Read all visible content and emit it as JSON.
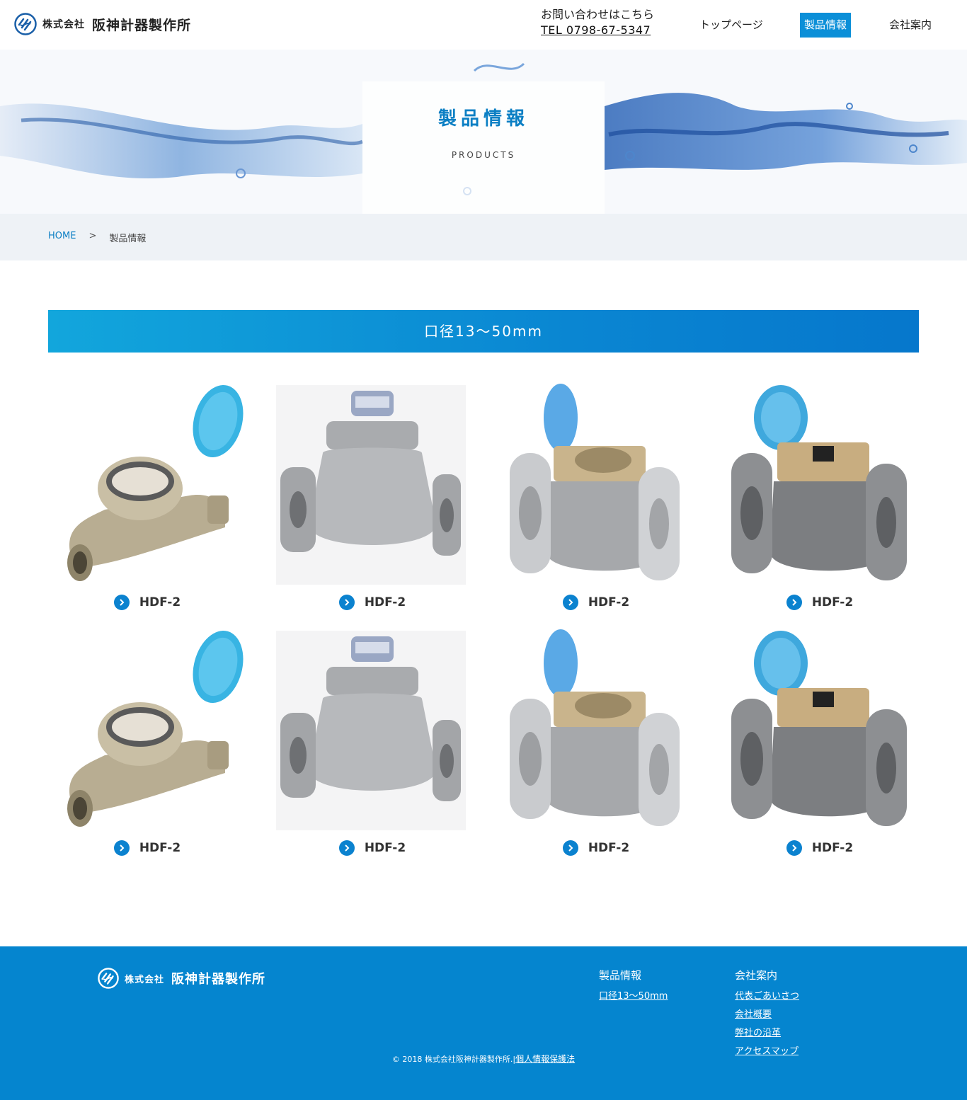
{
  "header": {
    "logo_small": "株式会社",
    "logo_big": "阪神計器製作所",
    "contact_label": "お問い合わせはこちら",
    "contact_tel": "TEL 0798-67-5347",
    "nav": [
      {
        "label": "トップページ"
      },
      {
        "label": "製品情報",
        "active": true
      },
      {
        "label": "会社案内"
      }
    ]
  },
  "hero": {
    "title": "製品情報",
    "subtitle": "PRODUCTS"
  },
  "breadcrumb": {
    "home": "HOME",
    "separator": ">",
    "current": "製品情報"
  },
  "section": {
    "title": "口径13～50mm"
  },
  "products": [
    {
      "name": "HDF-2",
      "image": "brass-meter"
    },
    {
      "name": "HDF-2",
      "image": "silver-flange-meter"
    },
    {
      "name": "HDF-2",
      "image": "gray-flange-meter"
    },
    {
      "name": "HDF-2",
      "image": "dark-flange-meter"
    },
    {
      "name": "HDF-2",
      "image": "brass-meter"
    },
    {
      "name": "HDF-2",
      "image": "silver-flange-meter"
    },
    {
      "name": "HDF-2",
      "image": "gray-flange-meter"
    },
    {
      "name": "HDF-2",
      "image": "dark-flange-meter"
    }
  ],
  "footer": {
    "logo_small": "株式会社",
    "logo_big": "阪神計器製作所",
    "col1": {
      "heading": "製品情報",
      "links": [
        "口径13～50mm"
      ]
    },
    "col2": {
      "heading": "会社案内",
      "links": [
        "代表ごあいさつ",
        "会社概要",
        "弊社の沿革",
        "アクセスマップ"
      ]
    },
    "copyright": "© 2018 株式会社阪神計器製作所.",
    "privacy": "個人情報保護法"
  },
  "colors": {
    "accent": "#0b8fd8",
    "footer_bg": "#0585cf",
    "title_blue": "#0b7fc4"
  }
}
